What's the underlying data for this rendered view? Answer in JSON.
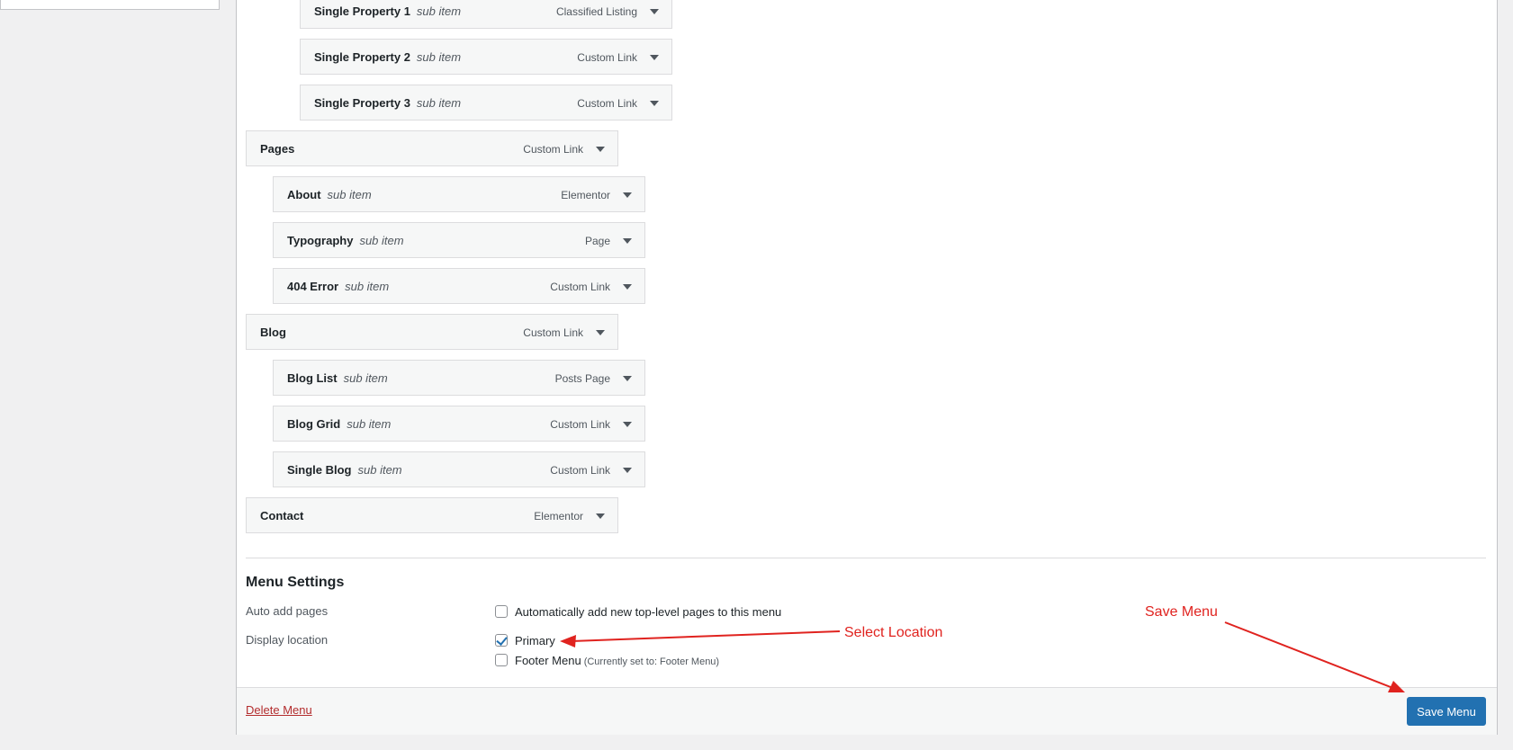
{
  "menu_items": [
    {
      "title": "Single Property 1",
      "sub": "sub item",
      "type": "Classified Listing"
    },
    {
      "title": "Single Property 2",
      "sub": "sub item",
      "type": "Custom Link"
    },
    {
      "title": "Single Property 3",
      "sub": "sub item",
      "type": "Custom Link"
    },
    {
      "title": "Pages",
      "sub": "",
      "type": "Custom Link"
    },
    {
      "title": "About",
      "sub": "sub item",
      "type": "Elementor"
    },
    {
      "title": "Typography",
      "sub": "sub item",
      "type": "Page"
    },
    {
      "title": "404 Error",
      "sub": "sub item",
      "type": "Custom Link"
    },
    {
      "title": "Blog",
      "sub": "",
      "type": "Custom Link"
    },
    {
      "title": "Blog List",
      "sub": "sub item",
      "type": "Posts Page"
    },
    {
      "title": "Blog Grid",
      "sub": "sub item",
      "type": "Custom Link"
    },
    {
      "title": "Single Blog",
      "sub": "sub item",
      "type": "Custom Link"
    },
    {
      "title": "Contact",
      "sub": "",
      "type": "Elementor"
    }
  ],
  "settings": {
    "title": "Menu Settings",
    "auto_add_label": "Auto add pages",
    "auto_add_option": "Automatically add new top-level pages to this menu",
    "auto_add_checked": false,
    "display_location_label": "Display location",
    "locations": [
      {
        "label": "Primary",
        "note": "",
        "checked": true
      },
      {
        "label": "Footer Menu",
        "note": "(Currently set to: Footer Menu)",
        "checked": false
      }
    ]
  },
  "footer": {
    "delete_label": "Delete Menu",
    "save_label": "Save Menu"
  },
  "annotations": {
    "select_location": "Select Location",
    "save_menu": "Save Menu",
    "color": "#e0231f"
  },
  "colors": {
    "accent": "#2271b1",
    "danger": "#b32d2e",
    "item_bg": "#f6f7f7"
  }
}
